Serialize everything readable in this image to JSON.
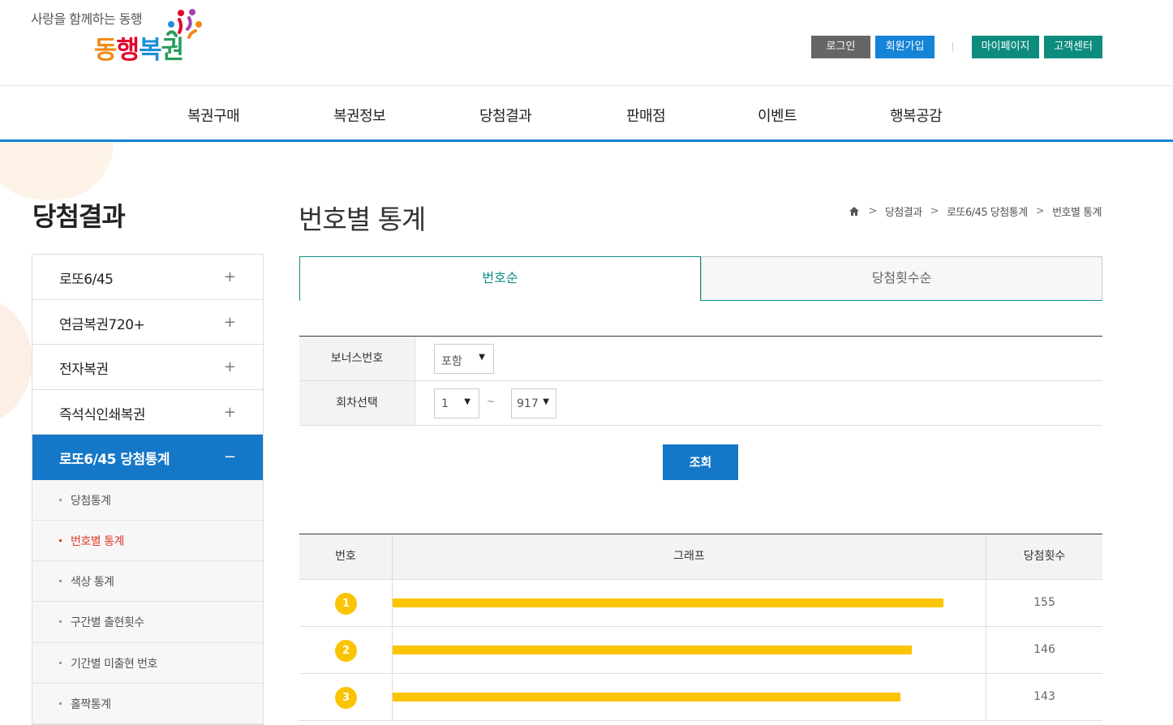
{
  "brand": {
    "tagline": "사랑을 함께하는 동행",
    "name_parts": [
      "동",
      "행",
      "복",
      "권"
    ]
  },
  "top_buttons": {
    "login": "로그인",
    "join": "회원가입",
    "mypage": "마이페이지",
    "cs": "고객센터"
  },
  "gnb": [
    "복권구매",
    "복권정보",
    "당첨결과",
    "판매점",
    "이벤트",
    "행복공감"
  ],
  "lnb": {
    "title": "당첨결과",
    "items": [
      "로또6/45",
      "연금복권720+",
      "전자복권",
      "즉석식인쇄복권"
    ],
    "active": "로또6/45 당첨통계",
    "subs": [
      "당첨통계",
      "번호별 통계",
      "색상 통계",
      "구간별 출현횟수",
      "기간별 미출현 번호",
      "홀짝통계"
    ],
    "plus": "+",
    "minus": "−"
  },
  "page": {
    "title": "번호별 통계",
    "breadcrumb": [
      "당첨결과",
      "로또6/45 당첨통계",
      "번호별 통계"
    ],
    "tabs": {
      "on": "번호순",
      "off": "당첨횟수순"
    }
  },
  "search": {
    "bonus_label": "보너스번호",
    "bonus_value": "포함",
    "round_label": "회차선택",
    "round_from": "1",
    "round_to": "917",
    "tilde": "~",
    "button": "조회"
  },
  "result": {
    "headers": {
      "number": "번호",
      "graph": "그래프",
      "count": "당첨횟수"
    },
    "rows": [
      {
        "number": "1",
        "count": "155",
        "value": 155
      },
      {
        "number": "2",
        "count": "146",
        "value": 146
      },
      {
        "number": "3",
        "count": "143",
        "value": 143
      }
    ]
  },
  "colors": {
    "accent_blue": "#1577c8",
    "accent_teal": "#0d8c7e",
    "ball_yellow": "#fbc400",
    "current_red": "#e23b2e"
  }
}
